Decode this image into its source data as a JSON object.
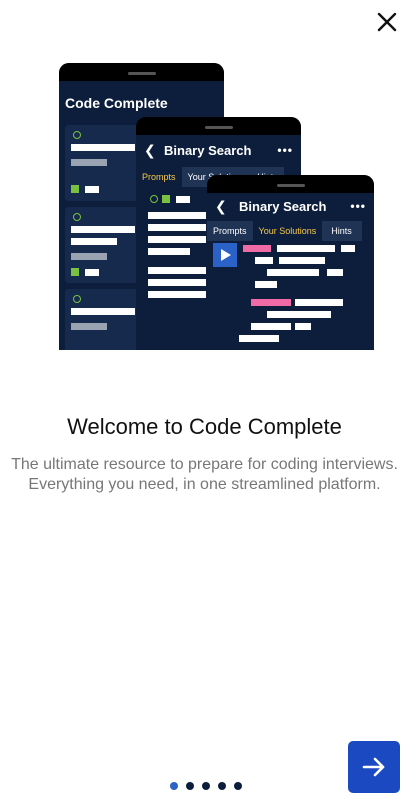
{
  "onboarding": {
    "title": "Welcome to Code Complete",
    "description": "The ultimate resource to prepare for coding interviews. Everything you need, in one streamlined platform.",
    "page_count": 5,
    "current_page": 1
  },
  "illustration": {
    "phone1_title": "Code Complete",
    "phone2_title": "Binary Search",
    "phone2_tabs": [
      "Prompts",
      "Your Solutions",
      "Hints"
    ],
    "phone3_title": "Binary Search",
    "phone3_tabs": [
      "Prompts",
      "Your Solutions",
      "Hints"
    ]
  },
  "icons": {
    "close": "close-icon",
    "next": "arrow-right-icon"
  },
  "colors": {
    "accent": "#1a49c2",
    "dot_active": "#2a62c7",
    "dot_inactive": "#0d1e3d",
    "phone_bg": "#0d1e3d",
    "tab_active": "#f7c948",
    "pink": "#f06aa6",
    "green": "#7ac142"
  }
}
